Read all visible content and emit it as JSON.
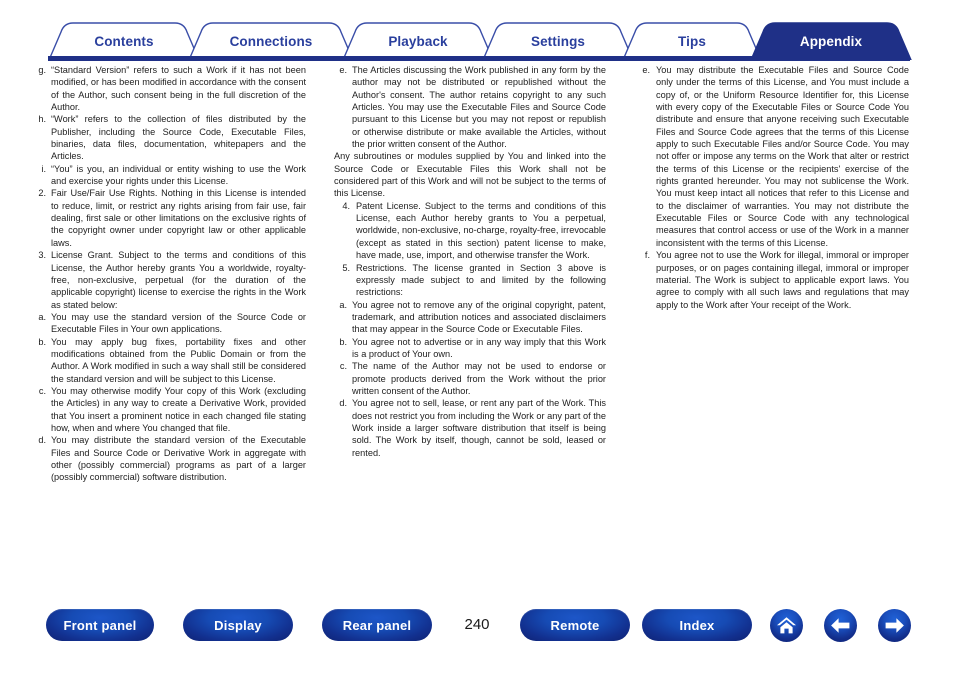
{
  "theme": {
    "brand_blue": "#1f3087",
    "tab_text_blue": "#2a3f9d",
    "pill_blue": "#12308f"
  },
  "tabs": [
    {
      "label": "Contents",
      "active": false
    },
    {
      "label": "Connections",
      "active": false
    },
    {
      "label": "Playback",
      "active": false
    },
    {
      "label": "Settings",
      "active": false
    },
    {
      "label": "Tips",
      "active": false
    },
    {
      "label": "Appendix",
      "active": true
    }
  ],
  "columns": {
    "col1": [
      {
        "marker": "g.",
        "type": "alpha",
        "text": "“Standard Version” refers to such a Work if it has not been modified, or has been modified in accordance with the consent of the Author, such consent being in the full discretion of the Author."
      },
      {
        "marker": "h.",
        "type": "alpha",
        "text": "“Work” refers to the collection of files distributed by the Publisher, including the Source Code, Executable Files, binaries, data files, documentation, whitepapers and the Articles."
      },
      {
        "marker": "i.",
        "type": "alpha",
        "text": "“You” is you, an individual or entity wishing to use the Work and exercise your rights under this License."
      },
      {
        "marker": "2.",
        "type": "num",
        "text": "Fair Use/Fair Use Rights. Nothing in this License is intended to reduce, limit, or restrict any rights arising from fair use, fair dealing, first sale or other limitations on the exclusive rights of the copyright owner under copyright law or other applicable laws."
      },
      {
        "marker": "3.",
        "type": "num",
        "text": "License Grant. Subject to the terms and conditions of this License, the Author hereby grants You a worldwide, royalty-free, non-exclusive, perpetual (for the duration of the applicable copyright) license to exercise the rights in the Work as stated below:"
      },
      {
        "marker": "a.",
        "type": "alpha",
        "text": "You may use the standard version of the Source Code or Executable Files in Your own applications."
      },
      {
        "marker": "b.",
        "type": "alpha",
        "text": "You may apply bug fixes, portability fixes and other modifications obtained from the Public Domain or from the Author. A Work modified in such a way shall still be considered the standard version and will be subject to this License."
      },
      {
        "marker": "c.",
        "type": "alpha",
        "text": "You may otherwise modify Your copy of this Work (excluding the Articles) in any way to create a Derivative Work, provided that You insert a prominent notice in each changed file stating how, when and where You changed that file."
      },
      {
        "marker": "d.",
        "type": "alpha",
        "text": "You may distribute the standard version of the Executable Files and Source Code or Derivative Work in aggregate with other (possibly commercial) programs as part of a larger (possibly commercial) software distribution."
      }
    ],
    "col2": [
      {
        "marker": "e.",
        "type": "alpha",
        "text": "The Articles discussing the Work published in any form by the author may not be distributed or republished without the Author's consent. The author retains copyright to any such Articles. You may use the Executable Files and Source Code pursuant to this License but you may not repost or republish or otherwise distribute or make available the Articles, without the prior written consent of the Author."
      },
      {
        "marker": "",
        "type": "plain",
        "text": "Any subroutines or modules supplied by You and linked into the Source Code or Executable Files this Work shall not be considered part of this Work and will not be subject to the terms of this License."
      },
      {
        "marker": "4.",
        "type": "num",
        "text": "Patent License. Subject to the terms and conditions of this License, each Author hereby grants to You a perpetual, worldwide, non-exclusive, no-charge, royalty-free, irrevocable (except as stated in this section) patent license to make, have made, use, import, and otherwise transfer the Work."
      },
      {
        "marker": "5.",
        "type": "num",
        "text": "Restrictions. The license granted in Section 3 above is expressly made subject to and limited by the following restrictions:"
      },
      {
        "marker": "a.",
        "type": "alpha",
        "text": "You agree not to remove any of the original copyright, patent, trademark, and attribution notices and associated disclaimers that may appear in the Source Code or Executable Files."
      },
      {
        "marker": "b.",
        "type": "alpha",
        "text": "You agree not to advertise or in any way imply that this Work is a product of Your own."
      },
      {
        "marker": "c.",
        "type": "alpha",
        "text": "The name of the Author may not be used to endorse or promote products derived from the Work without the prior written consent of the Author."
      },
      {
        "marker": "d.",
        "type": "alpha",
        "text": "You agree not to sell, lease, or rent any part of the Work. This does not restrict you from including the Work or any part of the Work inside a larger software distribution that itself is being sold. The Work by itself, though, cannot be sold, leased or rented."
      }
    ],
    "col3": [
      {
        "marker": "e.",
        "type": "alpha",
        "text": "You may distribute the Executable Files and Source Code only under the terms of this License, and You must include a copy of, or the Uniform Resource Identifier for, this License with every copy of the Executable Files or Source Code You distribute and ensure that anyone receiving such Executable Files and Source Code agrees that the terms of this License apply to such Executable Files and/or Source Code. You may not offer or impose any terms on the Work that alter or restrict the terms of this License or the recipients' exercise of the rights granted hereunder. You may not sublicense the Work. You must keep intact all notices that refer to this License and to the disclaimer of warranties. You may not distribute the Executable Files or Source Code with any technological measures that control access or use of the Work in a manner inconsistent with the terms of this License."
      },
      {
        "marker": "f.",
        "type": "alpha",
        "text": "You agree not to use the Work for illegal, immoral or improper purposes, or on pages containing illegal, immoral or improper material. The Work is subject to applicable export laws. You agree to comply with all such laws and regulations that may apply to the Work after Your receipt of the Work."
      }
    ]
  },
  "bottom_nav": {
    "front_panel": "Front panel",
    "display": "Display",
    "rear_panel": "Rear panel",
    "page_number": "240",
    "remote": "Remote",
    "index": "Index",
    "home_icon": "home-icon",
    "back_icon": "arrow-left-icon",
    "forward_icon": "arrow-right-icon"
  }
}
